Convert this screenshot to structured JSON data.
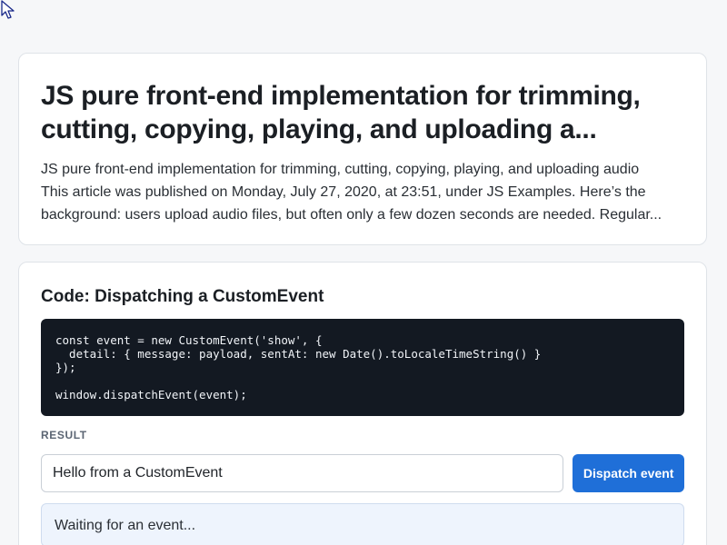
{
  "article": {
    "title_lines": [
      "JS pure front-end implementation for trimming,",
      "cutting, copying, playing, and uploading a..."
    ],
    "excerpt_lines": [
      "JS pure front-end implementation for trimming, cutting, copying, playing, and uploading audio",
      "This article was published on Monday, July 27, 2020, at 23:51, under JS Examples. Here’s the",
      "background: users upload audio files, but often only a few dozen seconds are needed. Regular..."
    ]
  },
  "code_section": {
    "title": "Code: Dispatching a CustomEvent",
    "code_lines": [
      "const event = new CustomEvent('show', {",
      "  detail: { message: payload, sentAt: new Date().toLocaleTimeString() }",
      "});",
      "",
      "window.dispatchEvent(event);"
    ],
    "result_label": "RESULT",
    "input_value": "Hello from a CustomEvent",
    "button_label": "Dispatch event",
    "status_text": "Waiting for an event..."
  },
  "colors": {
    "accent": "#1f6fd8",
    "code_background": "#131922",
    "status_background": "#eef4fd"
  },
  "icons": {
    "cursor": "mouse-pointer-icon"
  }
}
